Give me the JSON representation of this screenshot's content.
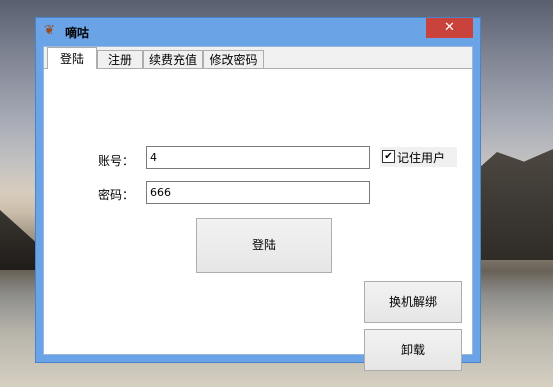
{
  "window": {
    "title": "嘀咕",
    "close_glyph": "✕",
    "icon": "app-emblem-icon"
  },
  "tabs": [
    {
      "label": "登陆",
      "active": true
    },
    {
      "label": "注册",
      "active": false
    },
    {
      "label": "续费充值",
      "active": false
    },
    {
      "label": "修改密码",
      "active": false
    }
  ],
  "login": {
    "account_label": "账号：",
    "account_value": "4",
    "password_label": "密码：",
    "password_value": "666",
    "remember_label": "记住用户",
    "remember_checked": true,
    "login_button": "登陆",
    "unbind_button": "换机解绑",
    "uninstall_button": "卸载"
  }
}
